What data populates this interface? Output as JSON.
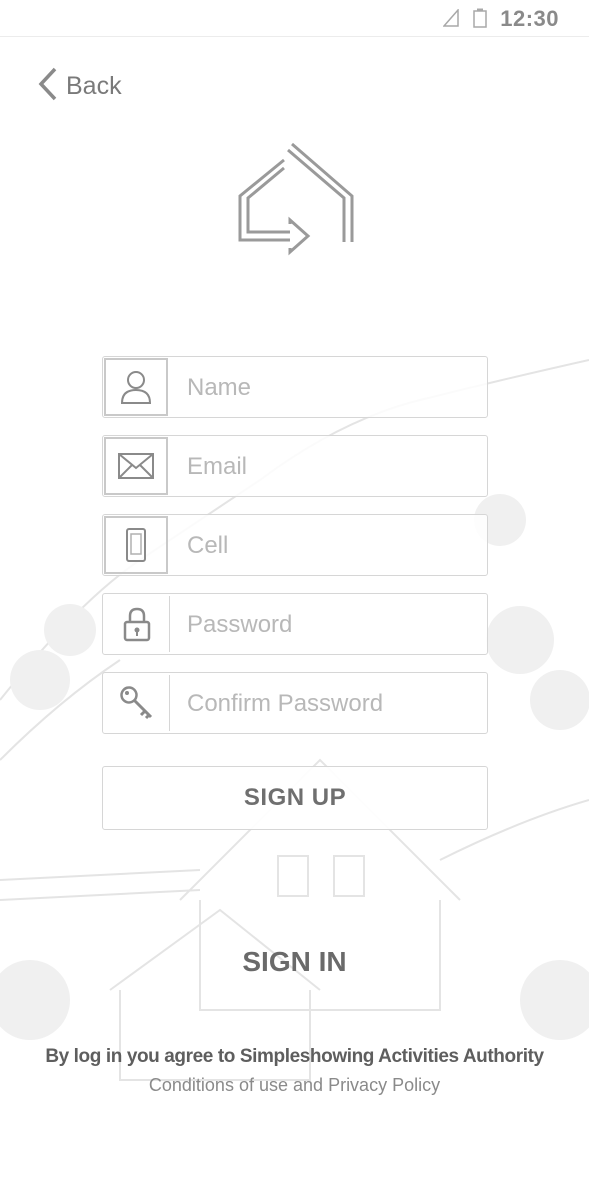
{
  "status_bar": {
    "time": "12:30"
  },
  "nav": {
    "back_label": "Back"
  },
  "form": {
    "name_placeholder": "Name",
    "email_placeholder": "Email",
    "cell_placeholder": "Cell",
    "password_placeholder": "Password",
    "confirm_password_placeholder": "Confirm Password",
    "signup_label": "SIGN UP"
  },
  "signin_label": "SIGN IN",
  "terms": {
    "line1": "By log in you agree to Simpleshowing Activities Authority",
    "conditions": "Conditions of use",
    "and": "and",
    "privacy": "Privacy Policy"
  },
  "icons": [
    "signal-icon",
    "battery-icon",
    "chevron-left-icon",
    "house-arrow-logo",
    "user-icon",
    "envelope-icon",
    "phone-icon",
    "lock-icon",
    "key-icon"
  ]
}
